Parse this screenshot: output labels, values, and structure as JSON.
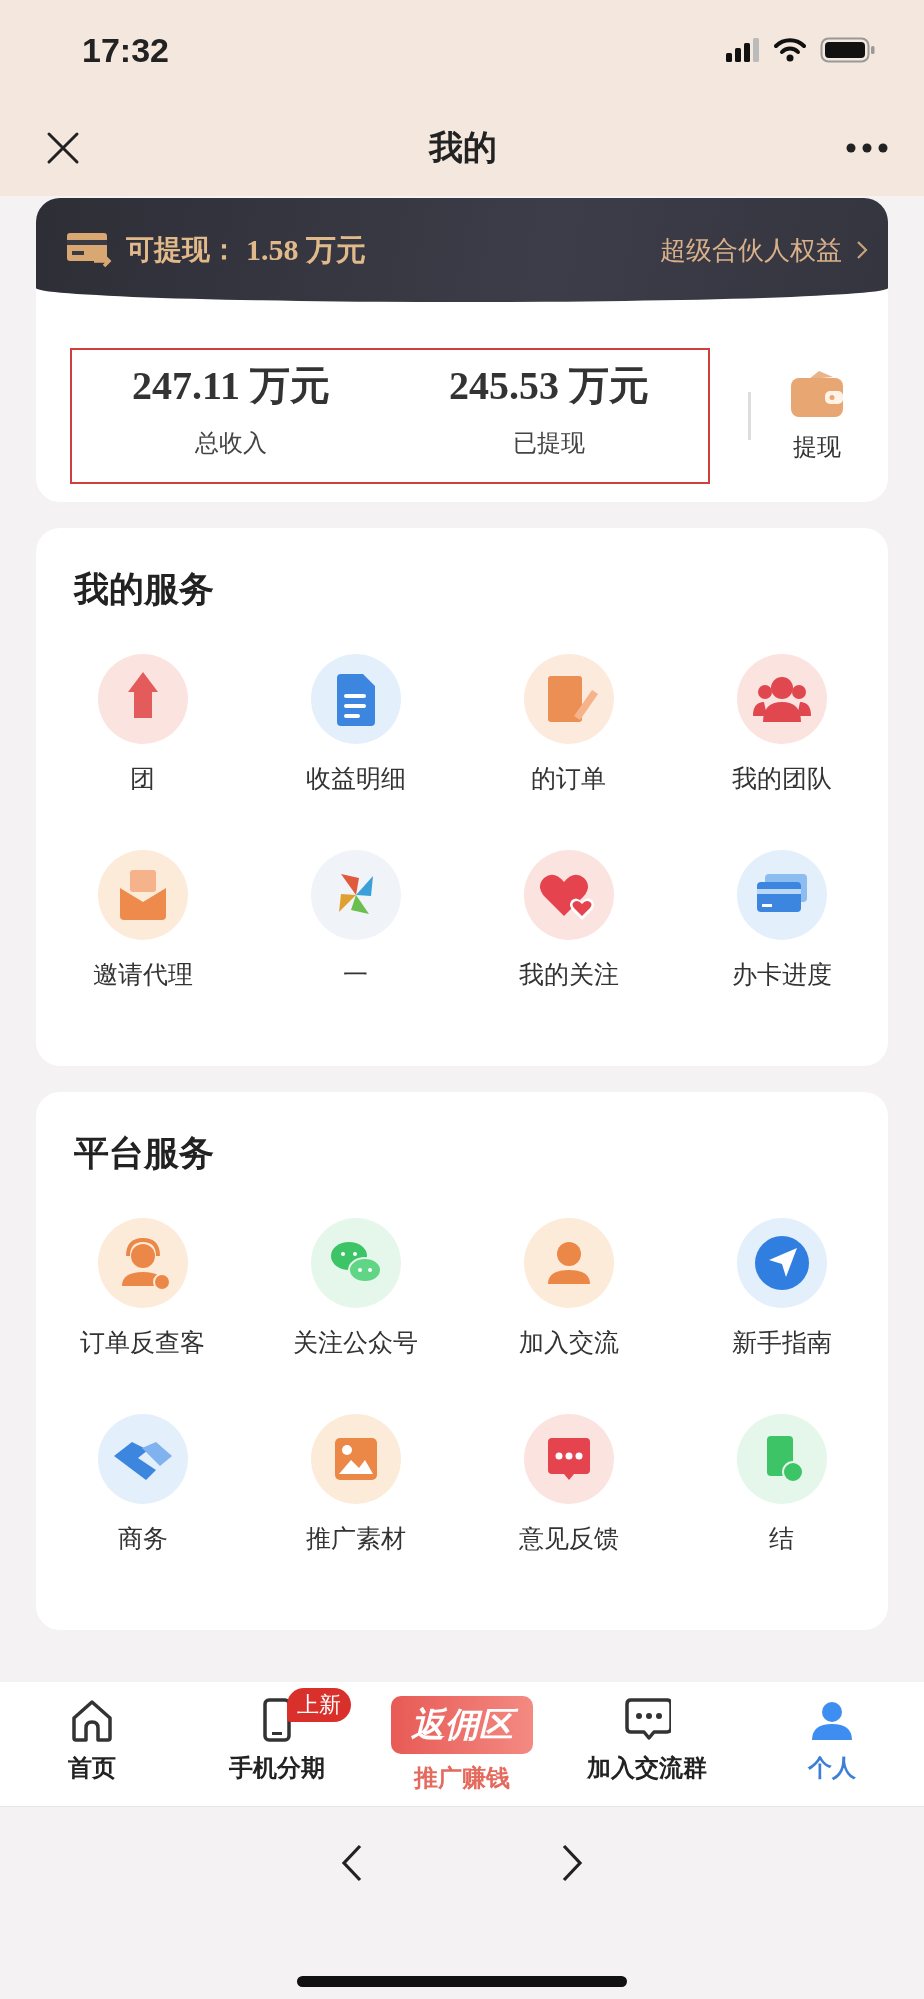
{
  "status_bar": {
    "time": "17:32"
  },
  "nav": {
    "title": "我的"
  },
  "balance": {
    "label": "可提现：",
    "amount": "1.58 万元",
    "link": "超级合伙人权益"
  },
  "stats": [
    {
      "value": "247.11 万元",
      "label": "总收入"
    },
    {
      "value": "245.53 万元",
      "label": "已提现"
    }
  ],
  "withdraw": {
    "label": "提现"
  },
  "sections": [
    {
      "title": "我的服务",
      "items": [
        {
          "label": "团"
        },
        {
          "label": "收益明细"
        },
        {
          "label": "的订单"
        },
        {
          "label": "我的团队"
        },
        {
          "label": "邀请代理"
        },
        {
          "label": "一"
        },
        {
          "label": "我的关注"
        },
        {
          "label": "办卡进度"
        }
      ]
    },
    {
      "title": "平台服务",
      "items": [
        {
          "label": "订单反查客"
        },
        {
          "label": "关注公众号"
        },
        {
          "label": "加入交流"
        },
        {
          "label": "新手指南"
        },
        {
          "label": "商务"
        },
        {
          "label": "推广素材"
        },
        {
          "label": "意见反馈"
        },
        {
          "label": "结"
        }
      ]
    }
  ],
  "tabs": [
    {
      "label": "首页",
      "kind": "icon",
      "selected": false
    },
    {
      "label": "手机分期",
      "kind": "icon",
      "badge": "上新",
      "selected": false
    },
    {
      "label": "推广赚钱",
      "kind": "banner",
      "banner": "返佣区",
      "selected": false
    },
    {
      "label": "加入交流群",
      "kind": "icon",
      "selected": false
    },
    {
      "label": "个人",
      "kind": "icon",
      "selected": true
    }
  ]
}
